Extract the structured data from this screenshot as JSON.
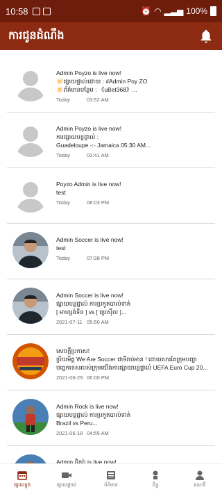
{
  "status_bar": {
    "time": "10:58",
    "battery": "100%"
  },
  "app_bar": {
    "title": "ការជូនដំណឹង"
  },
  "notifications": [
    {
      "avatar": "placeholder",
      "title": "Admin Poyzo is live now!",
      "lines": [
        "🔅ផ្សាយផ្ទាល់ដោយ : #Admin Poy ZO",
        "🔅ព័ត៌មានបន្ថែម : 《uBet368》..."
      ],
      "date": "Today",
      "time": "03:52 AM"
    },
    {
      "avatar": "placeholder",
      "title": "Admin Poyzo is live now!",
      "lines": [
        "ការផ្សាយបន្តផ្ទាល់ :",
        "Guadeloupe -:- Jamaica 05:30 AM..."
      ],
      "date": "Today",
      "time": "03:41 AM"
    },
    {
      "avatar": "placeholder",
      "title": "Poyzo Admin is live now!",
      "lines": [
        "test"
      ],
      "date": "Today",
      "time": "08:03 PM"
    },
    {
      "avatar": "person",
      "title": "Admin Soccer is live now!",
      "lines": [
        "test"
      ],
      "date": "Today",
      "time": "07:38 PM"
    },
    {
      "avatar": "person",
      "title": "Admin Soccer is live now!",
      "lines": [
        "ផ្សាយបន្តផ្ទាល់ ការប្រកួតបាល់ទាត់",
        "[ អាហ្សង់ទីន ] vs [ ប្រេស៊ីល ]..."
      ],
      "date": "2021-07-11",
      "time": "05:50 AM"
    },
    {
      "avatar": "was-logo",
      "title": "សេចក្តីប្រកាស!",
      "lines": [
        "ប្រិយមិត្ត We Are Soccer ជាទីរាប់អាន ! ដោយសារតែក្រុមបញ្ហា",
        "បច្ចេកទេសរបស់ក្រុមយើងការផ្សាយបន្តផ្ទាល់ UEFA Euro Cup 20..."
      ],
      "date": "2021-06-29",
      "time": "06:00 PM"
    },
    {
      "avatar": "player",
      "title": "Admin Rock is live now!",
      "lines": [
        "ផ្សាយបន្តផ្ទាល់ ការប្រកួតបាល់ទាត់",
        "Brazil  vs  Peru..."
      ],
      "date": "2021-06-18",
      "time": "04:55 AM"
    },
    {
      "avatar": "player",
      "title": "Admin ជិតរ៉ា is live now!",
      "lines": [],
      "date": "",
      "time": ""
    }
  ],
  "bottom_nav": [
    {
      "label": "ផ្សាយក្នុង",
      "icon": "calendar-icon",
      "active": true
    },
    {
      "label": "ផ្សាយផ្ទាល់",
      "icon": "video-icon",
      "active": false
    },
    {
      "label": "ព័ត៌មាន",
      "icon": "news-icon",
      "active": false
    },
    {
      "label": "ពិន្ទុ",
      "icon": "trophy-icon",
      "active": false
    },
    {
      "label": "គណនី",
      "icon": "profile-icon",
      "active": false
    }
  ],
  "colors": {
    "status_bar": "#6e1c0b",
    "app_bar": "#8c2a12",
    "accent": "#8c2a12"
  }
}
